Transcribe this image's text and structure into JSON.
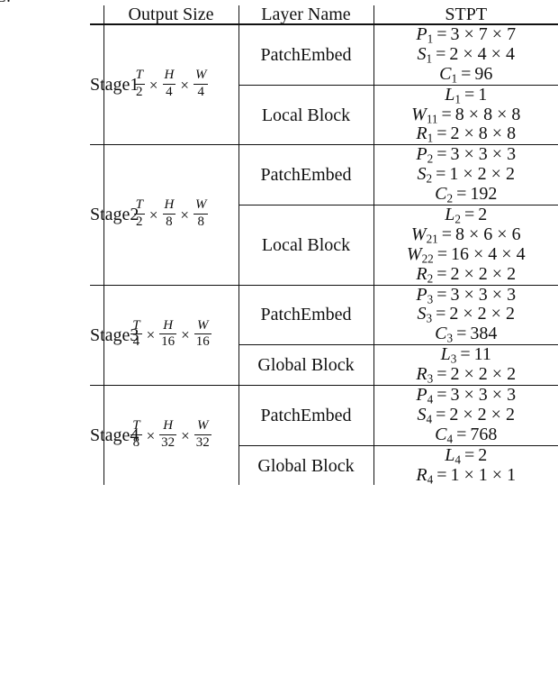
{
  "caption_fragment": "C.",
  "table": {
    "headers": {
      "stage": "",
      "output_size": "Output Size",
      "layer_name": "Layer Name",
      "stpt": "STPT"
    },
    "stages": [
      {
        "name": "Stage1",
        "output_size": {
          "t_num": "T",
          "t_den": "2",
          "h_num": "H",
          "h_den": "4",
          "w_num": "W",
          "w_den": "4"
        },
        "blocks": [
          {
            "layer_name": "PatchEmbed",
            "rows": [
              {
                "sym": "P",
                "sub": "1",
                "val": "3 × 7 × 7"
              },
              {
                "sym": "S",
                "sub": "1",
                "val": "2 × 4 × 4"
              },
              {
                "sym": "C",
                "sub": "1",
                "val": "96"
              }
            ]
          },
          {
            "layer_name": "Local Block",
            "rows": [
              {
                "sym": "L",
                "sub": "1",
                "val": "1"
              },
              {
                "sym": "W",
                "sub": "11",
                "val": "8 × 8 × 8"
              },
              {
                "sym": "R",
                "sub": "1",
                "val": "2 × 8 × 8"
              }
            ]
          }
        ]
      },
      {
        "name": "Stage2",
        "output_size": {
          "t_num": "T",
          "t_den": "2",
          "h_num": "H",
          "h_den": "8",
          "w_num": "W",
          "w_den": "8"
        },
        "blocks": [
          {
            "layer_name": "PatchEmbed",
            "rows": [
              {
                "sym": "P",
                "sub": "2",
                "val": "3 × 3 × 3"
              },
              {
                "sym": "S",
                "sub": "2",
                "val": "1 × 2 × 2"
              },
              {
                "sym": "C",
                "sub": "2",
                "val": "192"
              }
            ]
          },
          {
            "layer_name": "Local Block",
            "rows": [
              {
                "sym": "L",
                "sub": "2",
                "val": "2"
              },
              {
                "sym": "W",
                "sub": "21",
                "val": "8 × 6 × 6"
              },
              {
                "sym": "W",
                "sub": "22",
                "val": "16 × 4 × 4"
              },
              {
                "sym": "R",
                "sub": "2",
                "val": "2 × 2 × 2"
              }
            ]
          }
        ]
      },
      {
        "name": "Stage3",
        "output_size": {
          "t_num": "T",
          "t_den": "4",
          "h_num": "H",
          "h_den": "16",
          "w_num": "W",
          "w_den": "16"
        },
        "blocks": [
          {
            "layer_name": "PatchEmbed",
            "rows": [
              {
                "sym": "P",
                "sub": "3",
                "val": "3 × 3 × 3"
              },
              {
                "sym": "S",
                "sub": "3",
                "val": "2 × 2 × 2"
              },
              {
                "sym": "C",
                "sub": "3",
                "val": "384"
              }
            ]
          },
          {
            "layer_name": "Global Block",
            "rows": [
              {
                "sym": "L",
                "sub": "3",
                "val": "11"
              },
              {
                "sym": "R",
                "sub": "3",
                "val": "2 × 2 × 2"
              }
            ]
          }
        ]
      },
      {
        "name": "Stage4",
        "output_size": {
          "t_num": "T",
          "t_den": "8",
          "h_num": "H",
          "h_den": "32",
          "w_num": "W",
          "w_den": "32"
        },
        "blocks": [
          {
            "layer_name": "PatchEmbed",
            "rows": [
              {
                "sym": "P",
                "sub": "4",
                "val": "3 × 3 × 3"
              },
              {
                "sym": "S",
                "sub": "4",
                "val": "2 × 2 × 2"
              },
              {
                "sym": "C",
                "sub": "4",
                "val": "768"
              }
            ]
          },
          {
            "layer_name": "Global Block",
            "rows": [
              {
                "sym": "L",
                "sub": "4",
                "val": "2"
              },
              {
                "sym": "R",
                "sub": "4",
                "val": "1 × 1 × 1"
              }
            ]
          }
        ]
      }
    ]
  }
}
